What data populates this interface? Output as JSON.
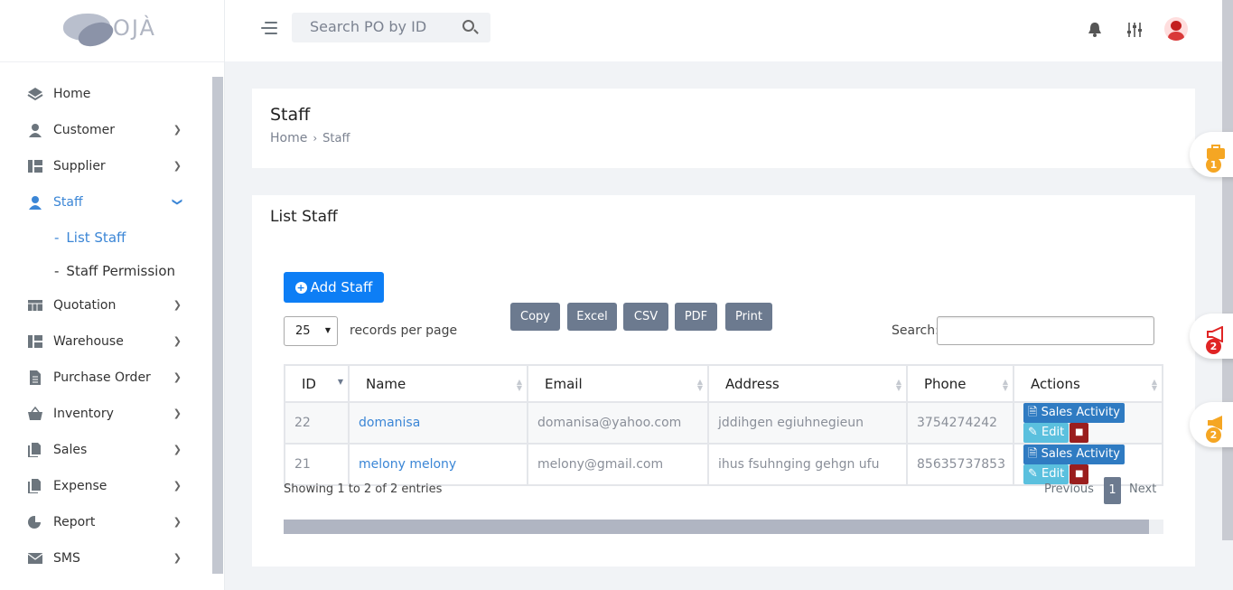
{
  "brand": {
    "logo_text": "OJÀ"
  },
  "topbar": {
    "search_placeholder": "Search PO by ID"
  },
  "sidebar": {
    "items": [
      {
        "label": "Home"
      },
      {
        "label": "Customer"
      },
      {
        "label": "Supplier"
      },
      {
        "label": "Staff"
      },
      {
        "label": "Quotation"
      },
      {
        "label": "Warehouse"
      },
      {
        "label": "Purchase Order"
      },
      {
        "label": "Inventory"
      },
      {
        "label": "Sales"
      },
      {
        "label": "Expense"
      },
      {
        "label": "Report"
      },
      {
        "label": "SMS"
      }
    ],
    "staff_sub": [
      {
        "label": "List Staff"
      },
      {
        "label": "Staff Permission"
      }
    ]
  },
  "header_card": {
    "title": "Staff",
    "breadcrumb_home": "Home",
    "breadcrumb_current": "Staff"
  },
  "list_card": {
    "title": "List Staff",
    "add_button": "Add Staff",
    "page_length": "25",
    "records_per_page": "records per page",
    "export_buttons": [
      "Copy",
      "Excel",
      "CSV",
      "PDF",
      "Print"
    ],
    "search_label": "Search:",
    "columns": [
      "ID",
      "Name",
      "Email",
      "Address",
      "Phone",
      "Actions"
    ],
    "rows": [
      {
        "id": "22",
        "name": "domanisa",
        "email": "domanisa@yahoo.com",
        "address": "jddihgen egiuhnegieun",
        "phone": "3754274242"
      },
      {
        "id": "21",
        "name": "melony melony",
        "email": "melony@gmail.com",
        "address": "ihus fsuhnging gehgn ufu",
        "phone": "85635737853"
      }
    ],
    "action_labels": {
      "sales_activity": "Sales Activity",
      "edit": "Edit"
    },
    "showing": "Showing 1 to 2 of 2 entries",
    "pagination": {
      "previous": "Previous",
      "current": "1",
      "next": "Next"
    }
  },
  "floating_badges": [
    "1",
    "2",
    "2"
  ],
  "colors": {
    "primary": "#0d7ef5",
    "active_nav": "#3b86d6",
    "export_btn": "#6c7a8f",
    "sales_btn": "#2f7bc2",
    "edit_btn": "#5bc0de",
    "delete_btn": "#9a1e1e"
  }
}
